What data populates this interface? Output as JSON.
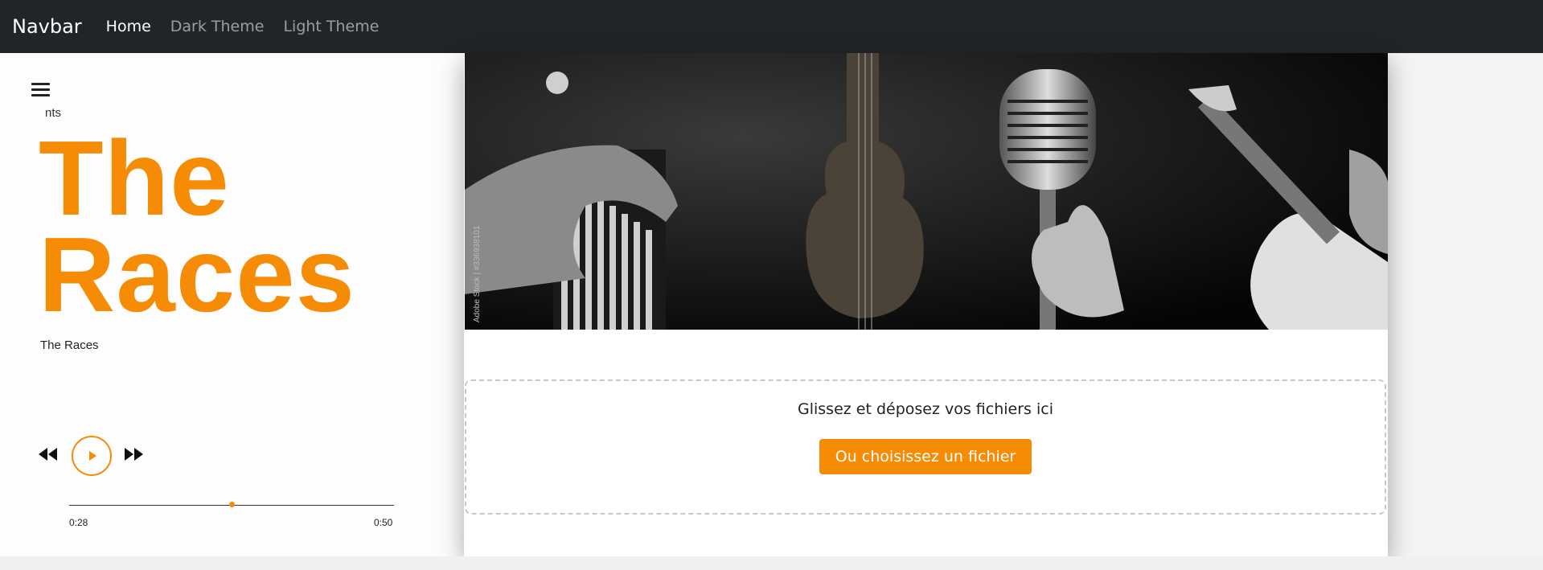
{
  "navbar": {
    "brand": "Navbar",
    "links": [
      {
        "label": "Home",
        "active": true
      },
      {
        "label": "Dark Theme",
        "active": false
      },
      {
        "label": "Light Theme",
        "active": false
      }
    ]
  },
  "player": {
    "menu_icon": "hamburger-icon",
    "playlist_peek": "nts",
    "title_line1": "The",
    "title_line2": "Races",
    "subtitle": "The Races",
    "controls": {
      "prev_icon": "rewind-icon",
      "play_icon": "play-icon",
      "next_icon": "fast-forward-icon"
    },
    "current_time": "0:28",
    "duration": "0:50",
    "progress": 0.5
  },
  "banner": {
    "watermark": "Adobe Stock | #336938101",
    "subjects": [
      "piano",
      "violin",
      "microphone",
      "guitar"
    ]
  },
  "upload": {
    "drop_text": "Glissez et déposez vos fichiers ici",
    "choose_label": "Ou choisissez un fichier"
  },
  "colors": {
    "accent": "#f68b05",
    "navbar_bg": "#212529"
  }
}
